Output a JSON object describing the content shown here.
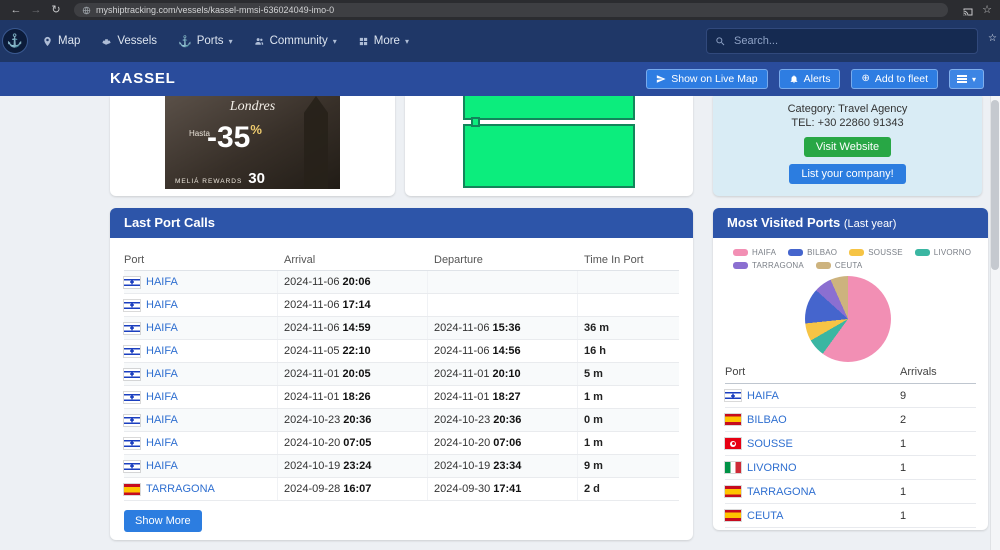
{
  "browser": {
    "url": "myshiptracking.com/vessels/kassel-mmsi-636024049-imo-0"
  },
  "icons": {
    "back": "←",
    "forward": "→",
    "reload": "↻",
    "star": "☆",
    "anchor": "⚓",
    "caret": "▾",
    "plus": "⊕"
  },
  "navbar": {
    "items": [
      {
        "label": "Map"
      },
      {
        "label": "Vessels"
      },
      {
        "label": "Ports"
      },
      {
        "label": "Community"
      },
      {
        "label": "More"
      }
    ],
    "search_placeholder": "Search..."
  },
  "header": {
    "title": "KASSEL",
    "buttons": [
      {
        "label": "Show on Live Map"
      },
      {
        "label": "Alerts"
      },
      {
        "label": "Add to fleet"
      }
    ]
  },
  "ad": {
    "title": "Londres",
    "subtitle": "Hasta",
    "discount": "-35",
    "percent": "%",
    "brand": "MELIÁ REWARDS",
    "brand2": "30"
  },
  "company": {
    "category": "Category: Travel Agency",
    "tel": "TEL: +30 22860 91343",
    "visit_button": "Visit Website",
    "list_button": "List your company!"
  },
  "lastPortCalls": {
    "title": "Last Port Calls",
    "columns": [
      "Port",
      "Arrival",
      "Departure",
      "Time In Port"
    ],
    "show_more": "Show More",
    "rows": [
      {
        "port": "HAIFA",
        "flag": "il",
        "arrival_date": "2024-11-06",
        "arrival_time": "20:06",
        "departure_date": "",
        "departure_time": "",
        "time_in_port": ""
      },
      {
        "port": "HAIFA",
        "flag": "il",
        "arrival_date": "2024-11-06",
        "arrival_time": "17:14",
        "departure_date": "",
        "departure_time": "",
        "time_in_port": ""
      },
      {
        "port": "HAIFA",
        "flag": "il",
        "arrival_date": "2024-11-06",
        "arrival_time": "14:59",
        "departure_date": "2024-11-06",
        "departure_time": "15:36",
        "time_in_port": "36 m"
      },
      {
        "port": "HAIFA",
        "flag": "il",
        "arrival_date": "2024-11-05",
        "arrival_time": "22:10",
        "departure_date": "2024-11-06",
        "departure_time": "14:56",
        "time_in_port": "16 h"
      },
      {
        "port": "HAIFA",
        "flag": "il",
        "arrival_date": "2024-11-01",
        "arrival_time": "20:05",
        "departure_date": "2024-11-01",
        "departure_time": "20:10",
        "time_in_port": "5 m"
      },
      {
        "port": "HAIFA",
        "flag": "il",
        "arrival_date": "2024-11-01",
        "arrival_time": "18:26",
        "departure_date": "2024-11-01",
        "departure_time": "18:27",
        "time_in_port": "1 m"
      },
      {
        "port": "HAIFA",
        "flag": "il",
        "arrival_date": "2024-10-23",
        "arrival_time": "20:36",
        "departure_date": "2024-10-23",
        "departure_time": "20:36",
        "time_in_port": "0 m"
      },
      {
        "port": "HAIFA",
        "flag": "il",
        "arrival_date": "2024-10-20",
        "arrival_time": "07:05",
        "departure_date": "2024-10-20",
        "departure_time": "07:06",
        "time_in_port": "1 m"
      },
      {
        "port": "HAIFA",
        "flag": "il",
        "arrival_date": "2024-10-19",
        "arrival_time": "23:24",
        "departure_date": "2024-10-19",
        "departure_time": "23:34",
        "time_in_port": "9 m"
      },
      {
        "port": "TARRAGONA",
        "flag": "es",
        "arrival_date": "2024-09-28",
        "arrival_time": "16:07",
        "departure_date": "2024-09-30",
        "departure_time": "17:41",
        "time_in_port": "2 d"
      }
    ]
  },
  "mostVisited": {
    "title": "Most Visited Ports",
    "subtitle": "(Last year)",
    "columns": [
      "Port",
      "Arrivals"
    ],
    "rows": [
      {
        "port": "HAIFA",
        "flag": "il",
        "arrivals": 9
      },
      {
        "port": "BILBAO",
        "flag": "es",
        "arrivals": 2
      },
      {
        "port": "SOUSSE",
        "flag": "tn",
        "arrivals": 1
      },
      {
        "port": "LIVORNO",
        "flag": "it",
        "arrivals": 1
      },
      {
        "port": "TARRAGONA",
        "flag": "es",
        "arrivals": 1
      },
      {
        "port": "CEUTA",
        "flag": "es",
        "arrivals": 1
      }
    ]
  },
  "chart_data": {
    "type": "pie",
    "title": "Most Visited Ports (Last year)",
    "categories": [
      "HAIFA",
      "BILBAO",
      "SOUSSE",
      "LIVORNO",
      "TARRAGONA",
      "CEUTA"
    ],
    "values": [
      9,
      2,
      1,
      1,
      1,
      1
    ],
    "colors": {
      "HAIFA": "#f28fb4",
      "BILBAO": "#4565cd",
      "SOUSSE": "#f6c445",
      "LIVORNO": "#3ab6a2",
      "TARRAGONA": "#8b6fd1",
      "CEUTA": "#cdb37e"
    },
    "slice_order": [
      "HAIFA",
      "LIVORNO",
      "SOUSSE",
      "BILBAO",
      "TARRAGONA",
      "CEUTA"
    ],
    "legend_position": "top"
  }
}
